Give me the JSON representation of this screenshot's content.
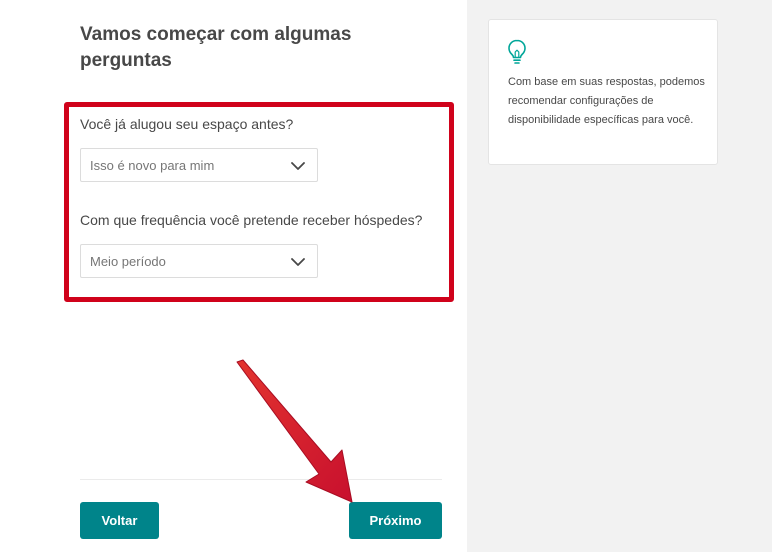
{
  "form": {
    "title": "Vamos começar com algumas perguntas",
    "question1": {
      "label": "Você já alugou seu espaço antes?",
      "selected": "Isso é novo para mim"
    },
    "question2": {
      "label": "Com que frequência você pretende receber hóspedes?",
      "selected": "Meio período"
    }
  },
  "footer": {
    "back_label": "Voltar",
    "next_label": "Próximo"
  },
  "tip": {
    "icon": "lightbulb-icon",
    "text": "Com base em suas respostas, podemos recomendar configurações de disponibilidade específicas para você."
  },
  "colors": {
    "accent": "#00848a",
    "annotation": "#d0021b",
    "text": "#484848",
    "sidebar_bg": "#f2f2f2"
  }
}
